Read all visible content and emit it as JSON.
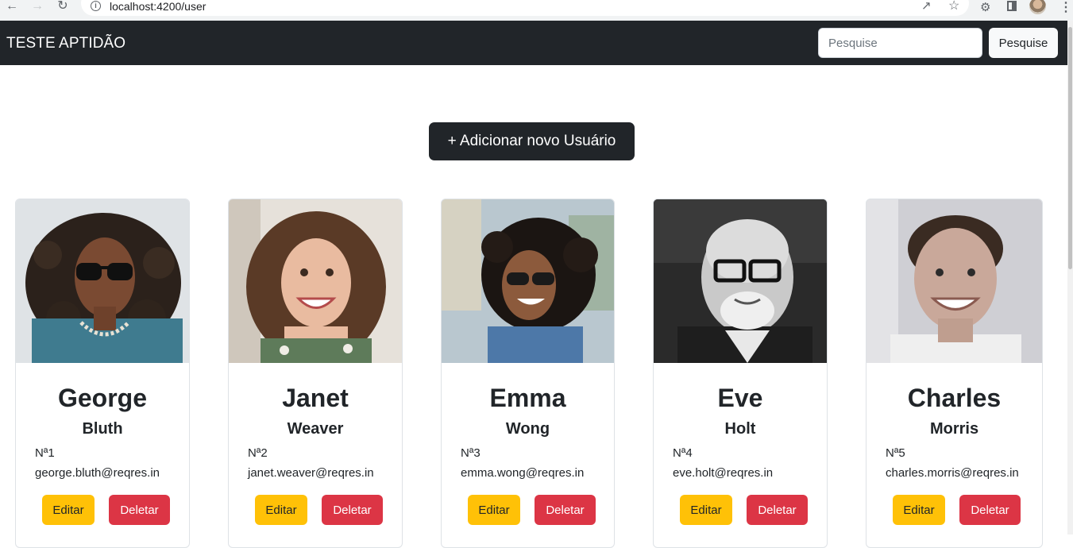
{
  "browser": {
    "url": "localhost:4200/user"
  },
  "navbar": {
    "brand": "TESTE APTIDÃO",
    "search_placeholder": "Pesquise",
    "search_button": "Pesquise"
  },
  "main": {
    "add_button": "+ Adicionar novo Usuário"
  },
  "users": [
    {
      "first_name": "George",
      "last_name": "Bluth",
      "number": "Nª1",
      "email": "george.bluth@reqres.in",
      "edit_label": "Editar",
      "delete_label": "Deletar"
    },
    {
      "first_name": "Janet",
      "last_name": "Weaver",
      "number": "Nª2",
      "email": "janet.weaver@reqres.in",
      "edit_label": "Editar",
      "delete_label": "Deletar"
    },
    {
      "first_name": "Emma",
      "last_name": "Wong",
      "number": "Nª3",
      "email": "emma.wong@reqres.in",
      "edit_label": "Editar",
      "delete_label": "Deletar"
    },
    {
      "first_name": "Eve",
      "last_name": "Holt",
      "number": "Nª4",
      "email": "eve.holt@reqres.in",
      "edit_label": "Editar",
      "delete_label": "Deletar"
    },
    {
      "first_name": "Charles",
      "last_name": "Morris",
      "number": "Nª5",
      "email": "charles.morris@reqres.in",
      "edit_label": "Editar",
      "delete_label": "Deletar"
    }
  ],
  "colors": {
    "navbar_bg": "#212529",
    "edit_button": "#ffc107",
    "delete_button": "#dc3545"
  }
}
